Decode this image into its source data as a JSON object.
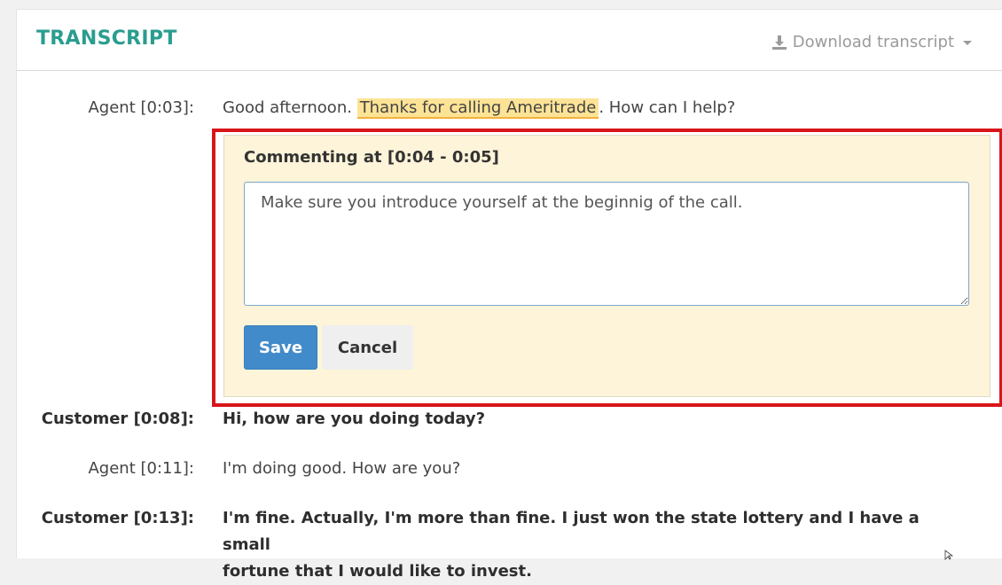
{
  "header": {
    "title": "TRANSCRIPT",
    "download_label": "Download transcript"
  },
  "transcript": [
    {
      "speaker": "Agent [0:03]:",
      "role": "agent",
      "before": "Good afternoon. ",
      "highlight": "Thanks for calling Ameritrade",
      "after": ". How can I help?"
    },
    {
      "speaker": "Customer [0:08]:",
      "role": "customer",
      "text": "Hi, how are you doing today?"
    },
    {
      "speaker": "Agent [0:11]:",
      "role": "agent",
      "text": "I'm doing good. How are you?"
    },
    {
      "speaker": "Customer [0:13]:",
      "role": "customer",
      "text_line1": "I'm fine. Actually, I'm more than fine. I just won the state lottery and I have a small",
      "text_line2": "fortune that I would like to invest."
    }
  ],
  "comment": {
    "label": "Commenting at [0:04 - 0:05]",
    "value": "Make sure you introduce yourself at the beginnig of the call.",
    "save_label": "Save",
    "cancel_label": "Cancel"
  },
  "colors": {
    "accent": "#2a9d8f",
    "highlight": "#fde396",
    "annotation_border": "#d81519",
    "primary_button": "#428bca",
    "comment_bg": "#fdf4d9"
  },
  "icons": {
    "download": "download-icon",
    "caret": "caret-down-icon"
  }
}
